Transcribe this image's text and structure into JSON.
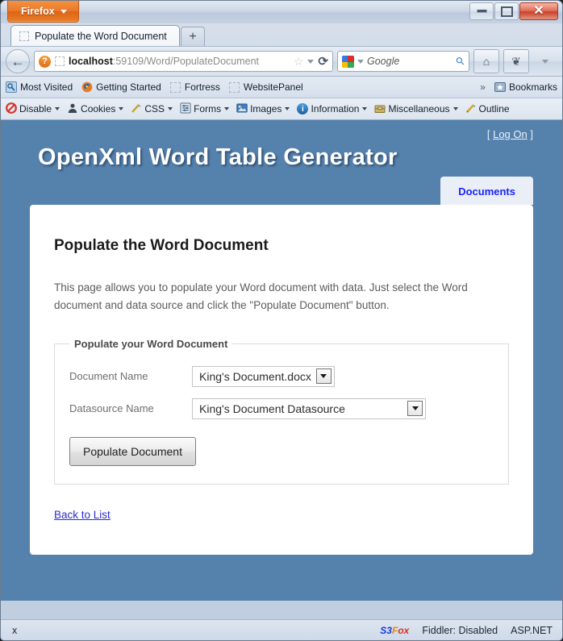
{
  "browser": {
    "app_button": "Firefox",
    "window_controls": {
      "minimize": "minimize-icon",
      "maximize": "maximize-icon",
      "close": "✕"
    },
    "tab": {
      "title": "Populate the Word Document",
      "favicon": "blank-page-icon"
    },
    "new_tab_label": "+",
    "nav": {
      "back_glyph": "←",
      "identity_glyph": "?",
      "url_host": "localhost",
      "url_rest": ":59109/Word/PopulateDocument",
      "star_glyph": "☆",
      "reload_glyph": "⟳",
      "home_glyph": "⌂",
      "search_placeholder": "Google",
      "search_value": "",
      "magnifier_glyph": "⚲",
      "addon_glyph": "❦"
    },
    "bookmarks": [
      {
        "label": "Most Visited",
        "icon": "most-visited-icon"
      },
      {
        "label": "Getting Started",
        "icon": "firefox-icon"
      },
      {
        "label": "Fortress",
        "icon": "blank-page-icon"
      },
      {
        "label": "WebsitePanel",
        "icon": "blank-page-icon"
      }
    ],
    "bookmarks_overflow": "»",
    "bookmarks_menu": {
      "label": "Bookmarks",
      "icon": "star-folder-icon"
    },
    "devbar": [
      {
        "label": "Disable",
        "icon": "disable-icon",
        "has_menu": true
      },
      {
        "label": "Cookies",
        "icon": "cookies-icon",
        "has_menu": true
      },
      {
        "label": "CSS",
        "icon": "css-icon",
        "has_menu": true
      },
      {
        "label": "Forms",
        "icon": "forms-icon",
        "has_menu": true
      },
      {
        "label": "Images",
        "icon": "images-icon",
        "has_menu": true
      },
      {
        "label": "Information",
        "icon": "information-icon",
        "has_menu": true
      },
      {
        "label": "Miscellaneous",
        "icon": "miscellaneous-icon",
        "has_menu": true
      },
      {
        "label": "Outline",
        "icon": "outline-icon",
        "has_menu": false
      }
    ]
  },
  "page": {
    "site_title": "OpenXml Word Table Generator",
    "logon_prefix": "[",
    "logon_label": "Log On",
    "logon_suffix": "]",
    "tabs": [
      {
        "label": "Documents",
        "active": true
      }
    ],
    "heading": "Populate the Word Document",
    "intro": "This page allows you to populate your Word document with data. Just select the Word document and data source and click the \"Populate Document\" button.",
    "fieldset_legend": "Populate your Word Document",
    "fields": [
      {
        "label": "Document Name",
        "value": "King's Document.docx",
        "name": "document-name-select"
      },
      {
        "label": "Datasource Name",
        "value": "King's Document Datasource",
        "name": "datasource-name-select"
      }
    ],
    "submit_label": "Populate Document",
    "back_link": "Back to List"
  },
  "statusbar": {
    "close_glyph": "x",
    "s3fox": {
      "part1": "S3",
      "part2": "F",
      "part3": "ox"
    },
    "fiddler": "Fiddler: Disabled",
    "aspnet": "ASP.NET"
  },
  "colors": {
    "accent_blue": "#5581ad",
    "firefox_orange": "#e8762a",
    "link_blue": "#2b2bd4",
    "tab_text_blue": "#1a24ff"
  }
}
